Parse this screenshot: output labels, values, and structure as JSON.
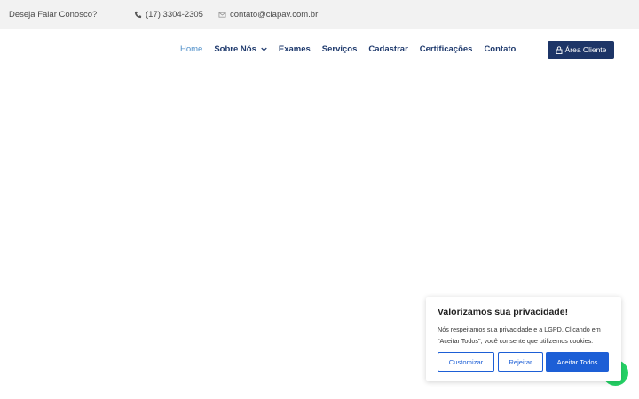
{
  "topbar": {
    "tagline": "Deseja Falar Conosco?",
    "phone": "(17) 3304-2305",
    "email": "contato@ciapav.com.br"
  },
  "nav": {
    "items": [
      {
        "label": "Home"
      },
      {
        "label": "Sobre Nós"
      },
      {
        "label": "Exames"
      },
      {
        "label": "Serviços"
      },
      {
        "label": "Cadastrar"
      },
      {
        "label": "Certificações"
      },
      {
        "label": "Contato"
      }
    ],
    "client_button": "Área Cliente"
  },
  "cookie": {
    "title": "Valorizamos sua privacidade!",
    "text": "Nós respeitamos sua privacidade e a LGPD.  Clicando em \"Aceitar Todos\", você consente que utilizemos cookies.",
    "customize": "Customizar",
    "reject": "Rejeitar",
    "accept": "Aceitar Todos"
  },
  "colors": {
    "nav_text": "#1f3a6d",
    "nav_active": "#4f8fc9",
    "client_button_bg": "#1d3567",
    "cookie_accent": "#1d5fd6",
    "whatsapp": "#25d366"
  },
  "icons": {
    "phone": "phone-icon",
    "email": "envelope-icon",
    "dropdown": "chevron-down-icon",
    "lock": "lock-icon",
    "whatsapp": "whatsapp-icon"
  }
}
